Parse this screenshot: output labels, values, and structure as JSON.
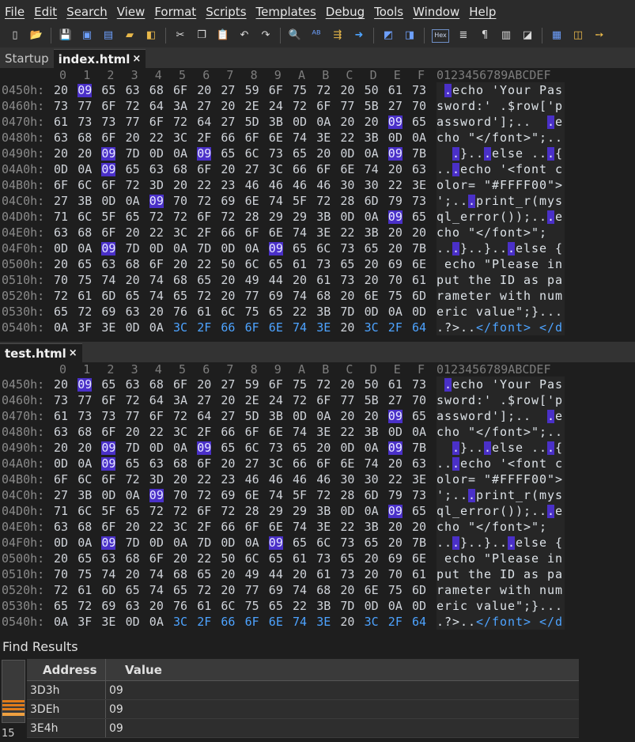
{
  "menu": [
    "File",
    "Edit",
    "Search",
    "View",
    "Format",
    "Scripts",
    "Templates",
    "Debug",
    "Tools",
    "Window",
    "Help"
  ],
  "toolbar": {
    "icons": [
      "new-file-icon",
      "open-file-icon",
      "save-icon",
      "save-as-icon",
      "save-all-icon",
      "folder-icon",
      "open-project-icon",
      "cut-icon",
      "copy-icon",
      "paste-icon",
      "undo-icon",
      "redo-icon",
      "find-icon",
      "replace-icon",
      "find-in-files-icon",
      "goto-icon",
      "compare-icon",
      "inspector-icon",
      "hex-mode-icon",
      "binary-icon",
      "paragraph-icon",
      "columns-icon",
      "highlighter-icon",
      "calculator-icon",
      "clipboard-icon",
      "bookmark-icon"
    ],
    "hex_label": "Hex"
  },
  "tabs_top": [
    {
      "label": "Startup",
      "active": false,
      "closable": false
    },
    {
      "label": "index.html",
      "active": true,
      "closable": true
    }
  ],
  "tabs_bottom": [
    {
      "label": "test.html",
      "active": true,
      "closable": true
    }
  ],
  "close_glyph": "×",
  "hex": {
    "columns": [
      "0",
      "1",
      "2",
      "3",
      "4",
      "5",
      "6",
      "7",
      "8",
      "9",
      "A",
      "B",
      "C",
      "D",
      "E",
      "F"
    ],
    "ascii_header": "0123456789ABCDEF",
    "rows": [
      {
        "addr": "0450h:",
        "bytes": [
          "20",
          "09",
          "65",
          "63",
          "68",
          "6F",
          "20",
          "27",
          "59",
          "6F",
          "75",
          "72",
          "20",
          "50",
          "61",
          "73"
        ],
        "ascii": " .echo 'Your Pas"
      },
      {
        "addr": "0460h:",
        "bytes": [
          "73",
          "77",
          "6F",
          "72",
          "64",
          "3A",
          "27",
          "20",
          "2E",
          "24",
          "72",
          "6F",
          "77",
          "5B",
          "27",
          "70"
        ],
        "ascii": "sword:' .$row['p"
      },
      {
        "addr": "0470h:",
        "bytes": [
          "61",
          "73",
          "73",
          "77",
          "6F",
          "72",
          "64",
          "27",
          "5D",
          "3B",
          "0D",
          "0A",
          "20",
          "20",
          "09",
          "65"
        ],
        "ascii": "assword'];..  .e"
      },
      {
        "addr": "0480h:",
        "bytes": [
          "63",
          "68",
          "6F",
          "20",
          "22",
          "3C",
          "2F",
          "66",
          "6F",
          "6E",
          "74",
          "3E",
          "22",
          "3B",
          "0D",
          "0A"
        ],
        "ascii": "cho \"</font>\";.."
      },
      {
        "addr": "0490h:",
        "bytes": [
          "20",
          "20",
          "09",
          "7D",
          "0D",
          "0A",
          "09",
          "65",
          "6C",
          "73",
          "65",
          "20",
          "0D",
          "0A",
          "09",
          "7B"
        ],
        "ascii": "  .}...else ...{"
      },
      {
        "addr": "04A0h:",
        "bytes": [
          "0D",
          "0A",
          "09",
          "65",
          "63",
          "68",
          "6F",
          "20",
          "27",
          "3C",
          "66",
          "6F",
          "6E",
          "74",
          "20",
          "63"
        ],
        "ascii": "...echo '<font c"
      },
      {
        "addr": "04B0h:",
        "bytes": [
          "6F",
          "6C",
          "6F",
          "72",
          "3D",
          "20",
          "22",
          "23",
          "46",
          "46",
          "46",
          "46",
          "30",
          "30",
          "22",
          "3E"
        ],
        "ascii": "olor= \"#FFFF00\">"
      },
      {
        "addr": "04C0h:",
        "bytes": [
          "27",
          "3B",
          "0D",
          "0A",
          "09",
          "70",
          "72",
          "69",
          "6E",
          "74",
          "5F",
          "72",
          "28",
          "6D",
          "79",
          "73"
        ],
        "ascii": "';...print_r(mys"
      },
      {
        "addr": "04D0h:",
        "bytes": [
          "71",
          "6C",
          "5F",
          "65",
          "72",
          "72",
          "6F",
          "72",
          "28",
          "29",
          "29",
          "3B",
          "0D",
          "0A",
          "09",
          "65"
        ],
        "ascii": "ql_error());...e"
      },
      {
        "addr": "04E0h:",
        "bytes": [
          "63",
          "68",
          "6F",
          "20",
          "22",
          "3C",
          "2F",
          "66",
          "6F",
          "6E",
          "74",
          "3E",
          "22",
          "3B",
          "20",
          "20"
        ],
        "ascii": "cho \"</font>\";  "
      },
      {
        "addr": "04F0h:",
        "bytes": [
          "0D",
          "0A",
          "09",
          "7D",
          "0D",
          "0A",
          "7D",
          "0D",
          "0A",
          "09",
          "65",
          "6C",
          "73",
          "65",
          "20",
          "7B"
        ],
        "ascii": "...}..}...else {"
      },
      {
        "addr": "0500h:",
        "bytes": [
          "20",
          "65",
          "63",
          "68",
          "6F",
          "20",
          "22",
          "50",
          "6C",
          "65",
          "61",
          "73",
          "65",
          "20",
          "69",
          "6E"
        ],
        "ascii": " echo \"Please in"
      },
      {
        "addr": "0510h:",
        "bytes": [
          "70",
          "75",
          "74",
          "20",
          "74",
          "68",
          "65",
          "20",
          "49",
          "44",
          "20",
          "61",
          "73",
          "20",
          "70",
          "61"
        ],
        "ascii": "put the ID as pa"
      },
      {
        "addr": "0520h:",
        "bytes": [
          "72",
          "61",
          "6D",
          "65",
          "74",
          "65",
          "72",
          "20",
          "77",
          "69",
          "74",
          "68",
          "20",
          "6E",
          "75",
          "6D"
        ],
        "ascii": "rameter with num"
      },
      {
        "addr": "0530h:",
        "bytes": [
          "65",
          "72",
          "69",
          "63",
          "20",
          "76",
          "61",
          "6C",
          "75",
          "65",
          "22",
          "3B",
          "7D",
          "0D",
          "0A",
          "0D"
        ],
        "ascii": "eric value\";}..."
      },
      {
        "addr": "0540h:",
        "bytes": [
          "0A",
          "3F",
          "3E",
          "0D",
          "0A",
          "3C",
          "2F",
          "66",
          "6F",
          "6E",
          "74",
          "3E",
          "20",
          "3C",
          "2F",
          "64"
        ],
        "ascii": ".?>..</font> </d"
      }
    ],
    "highlight_byte": "09",
    "tag_row": "0540h:",
    "tag_columns": [
      5,
      6,
      7,
      8,
      9,
      10,
      11,
      13,
      14,
      15
    ],
    "tag_ascii_range": [
      5,
      16
    ]
  },
  "find": {
    "title": "Find Results",
    "col_address": "Address",
    "col_value": "Value",
    "rows": [
      {
        "address": "3D3h",
        "value": "09"
      },
      {
        "address": "3DEh",
        "value": "09"
      },
      {
        "address": "3E4h",
        "value": "09"
      }
    ],
    "count": "15"
  },
  "colors": {
    "highlight_bg": "#4a30c8",
    "tag_text": "#4da3ff",
    "background": "#1e1e1e"
  }
}
